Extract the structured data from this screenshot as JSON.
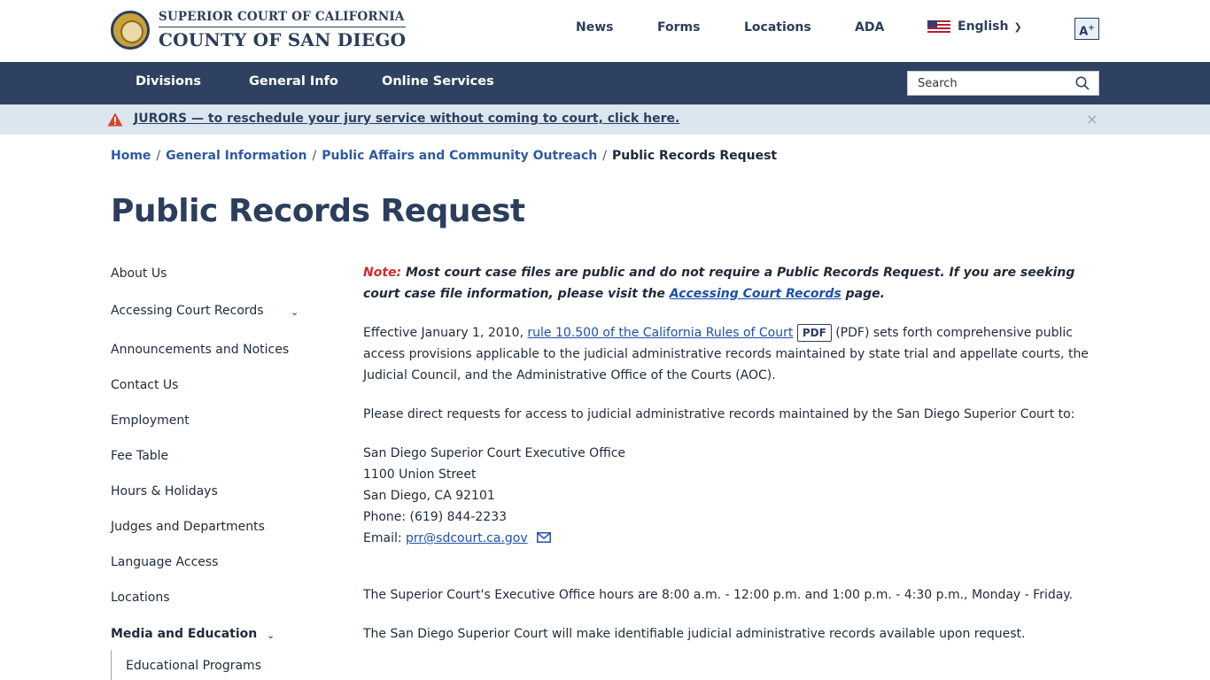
{
  "header": {
    "logo_line1": "SUPERIOR COURT OF CALIFORNIA",
    "logo_line2": "COUNTY OF SAN DIEGO",
    "nav": [
      "News",
      "Forms",
      "Locations",
      "ADA"
    ],
    "language": "English",
    "text_size_button": "A",
    "text_size_sup": "+"
  },
  "mainnav": {
    "items": [
      "Divisions",
      "General Info",
      "Online Services"
    ],
    "search_placeholder": "Search"
  },
  "alert": {
    "text": "JURORS — to reschedule your jury service without coming to court, click here.",
    "close": "×"
  },
  "breadcrumb": [
    "Home",
    "General Information",
    "Public Affairs and Community Outreach",
    "Public Records Request"
  ],
  "page_title": "Public Records Request",
  "sidebar": {
    "items": [
      "About Us",
      "Accessing Court Records",
      "Announcements and Notices",
      "Contact Us",
      "Employment",
      "Fee Table",
      "Hours & Holidays",
      "Judges and Departments",
      "Language Access",
      "Locations",
      "Media and Education",
      "Educational Programs"
    ]
  },
  "content": {
    "note_label": "Note:",
    "note_text": "Most court case files are public and do not require a Public Records Request. If you are seeking court case file information, please visit the",
    "note_link": "Accessing Court  Records",
    "note_end": "page.",
    "p1_start": "Effective January 1, 2010,",
    "p1_link": "rule 10.500 of the California Rules of Court",
    "p1_badge": "PDF",
    "p1_end": "(PDF) sets forth comprehensive public access provisions applicable to the judicial administrative records maintained by state trial and appellate courts, the Judicial Council, and the Administrative Office of the Courts (AOC).",
    "p2": "Please direct requests for access to judicial administrative records maintained by the San Diego Superior Court to:",
    "address": [
      "San Diego Superior Court Executive Office",
      "1100 Union Street",
      "San Diego, CA 92101",
      "Phone: (619) 844-2233"
    ],
    "email_label": "Email:",
    "email": "prr@sdcourt.ca.gov",
    "p3": "The Superior Court's Executive Office hours are 8:00 a.m. - 12:00 p.m. and 1:00 p.m. - 4:30 p.m., Monday - Friday.",
    "p4": "The San Diego Superior Court will make identifiable judicial administrative records available upon request."
  }
}
